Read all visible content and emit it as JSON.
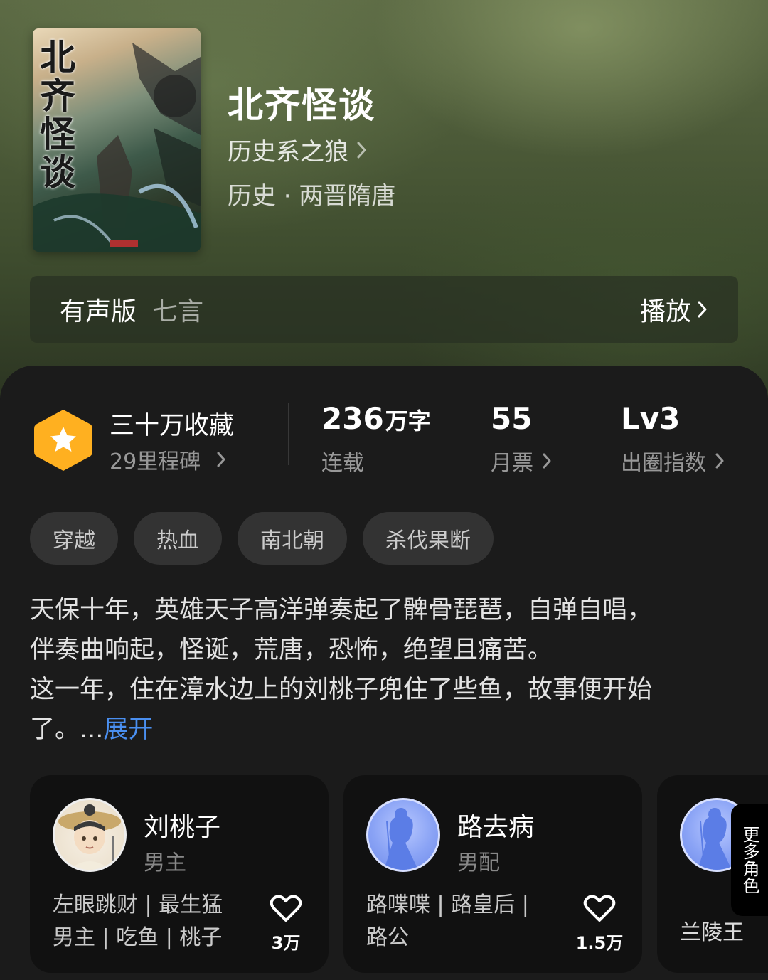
{
  "book": {
    "cover_title": "北齐怪谈",
    "title": "北齐怪谈",
    "author": "历史系之狼",
    "genre": "历史 · 两晋隋唐"
  },
  "audio": {
    "label": "有声版",
    "narrator": "七言",
    "play_label": "播放"
  },
  "stats": {
    "collection_main": "三十万收藏",
    "collection_sub": "29里程碑",
    "words_value": "236",
    "words_unit": "万字",
    "words_label": "连载",
    "votes_value": "55",
    "votes_label": "月票",
    "level_value": "Lv3",
    "level_label": "出圈指数"
  },
  "tags": [
    "穿越",
    "热血",
    "南北朝",
    "杀伐果断"
  ],
  "synopsis": {
    "line1": "天保十年，英雄天子高洋弹奏起了髀骨琵琶，自弹自唱，",
    "line2": "伴奏曲响起，怪诞，荒唐，恐怖，绝望且痛苦。",
    "line3": "这一年，住在漳水边上的刘桃子兜住了些鱼，故事便开始",
    "line4": "了。...",
    "expand_label": "展开"
  },
  "characters": [
    {
      "name": "刘桃子",
      "role": "男主",
      "desc_line1": "左眼跳财 | 最生猛",
      "desc_line2": "男主 | 吃鱼 | 桃子",
      "likes": "3万"
    },
    {
      "name": "路去病",
      "role": "男配",
      "desc_line1": "路喋喋 | 路皇后 |",
      "desc_line2": "路公",
      "likes": "1.5万"
    },
    {
      "name": "兰陵王"
    }
  ],
  "more_roles_label": "更多角色",
  "colors": {
    "accent_blue": "#4a8ff0",
    "badge_orange": "#ffb020",
    "panel_bg": "#1b1b1b",
    "card_bg": "#111111",
    "tag_bg": "#333333"
  }
}
